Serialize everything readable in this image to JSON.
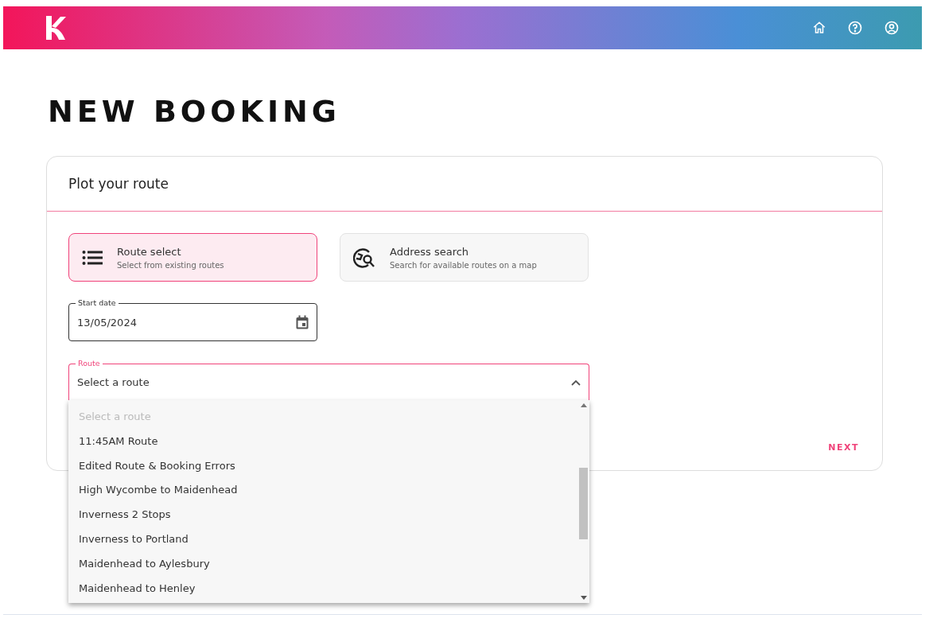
{
  "page_title": "NEW BOOKING",
  "card": {
    "title": "Plot your route",
    "modes": [
      {
        "kind": "list",
        "title": "Route select",
        "subtitle": "Select from existing routes",
        "selected": true
      },
      {
        "kind": "map",
        "title": "Address search",
        "subtitle": "Search for available routes on a map",
        "selected": false
      }
    ],
    "start_date": {
      "label": "Start date",
      "value": "13/05/2024"
    },
    "route": {
      "label": "Route",
      "value": "Select a route",
      "expanded": true,
      "options": [
        {
          "label": "Select a route",
          "disabled": true
        },
        {
          "label": "11:45AM Route",
          "disabled": false
        },
        {
          "label": "Edited Route & Booking Errors",
          "disabled": false
        },
        {
          "label": "High Wycombe to Maidenhead",
          "disabled": false
        },
        {
          "label": "Inverness 2 Stops",
          "disabled": false
        },
        {
          "label": "Inverness to Portland",
          "disabled": false
        },
        {
          "label": "Maidenhead to Aylesbury",
          "disabled": false
        },
        {
          "label": "Maidenhead to Henley",
          "disabled": false
        }
      ]
    },
    "next_button": "NEXT"
  }
}
